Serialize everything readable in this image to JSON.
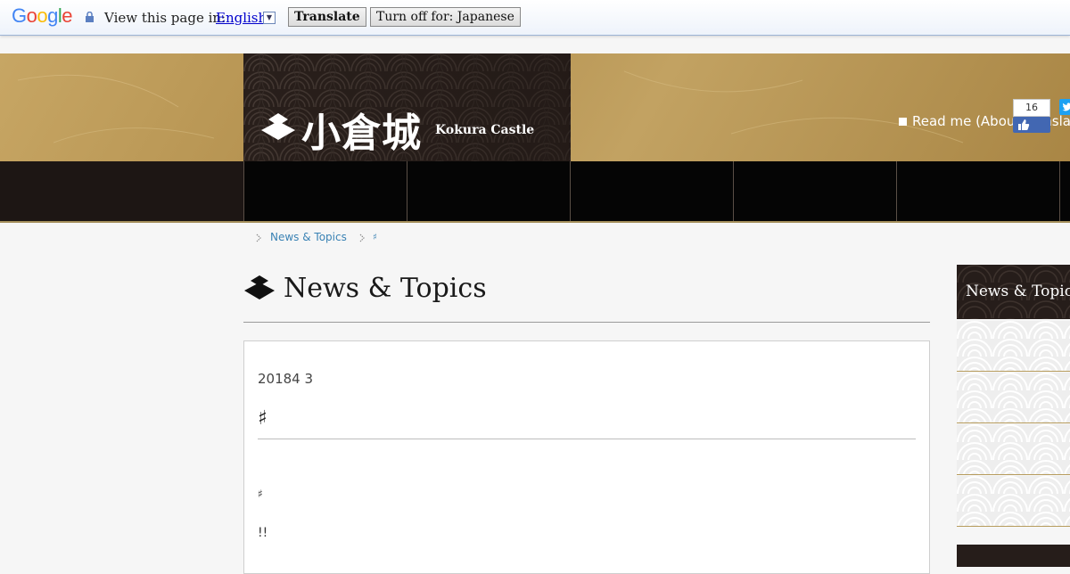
{
  "translate_bar": {
    "logo": "Google",
    "prompt": "View this page in:",
    "language": "English",
    "translate_button": "Translate",
    "turn_off_button": "Turn off for: Japanese"
  },
  "header": {
    "logo_jp": "小倉城",
    "logo_en": "Kokura Castle",
    "readme": "Read me (About translati",
    "like_count": "16"
  },
  "breadcrumb": {
    "items": [
      "News & Topics",
      "♯"
    ]
  },
  "main": {
    "title": "News & Topics",
    "article": {
      "date": "20184 3",
      "title": "♯",
      "para1": "♯",
      "para2": "!!"
    }
  },
  "sidebar": {
    "heading": "News & Topics"
  },
  "colors": {
    "accent_gold": "#b79c5d",
    "dark": "#261d1a",
    "link": "#3a82b4"
  }
}
